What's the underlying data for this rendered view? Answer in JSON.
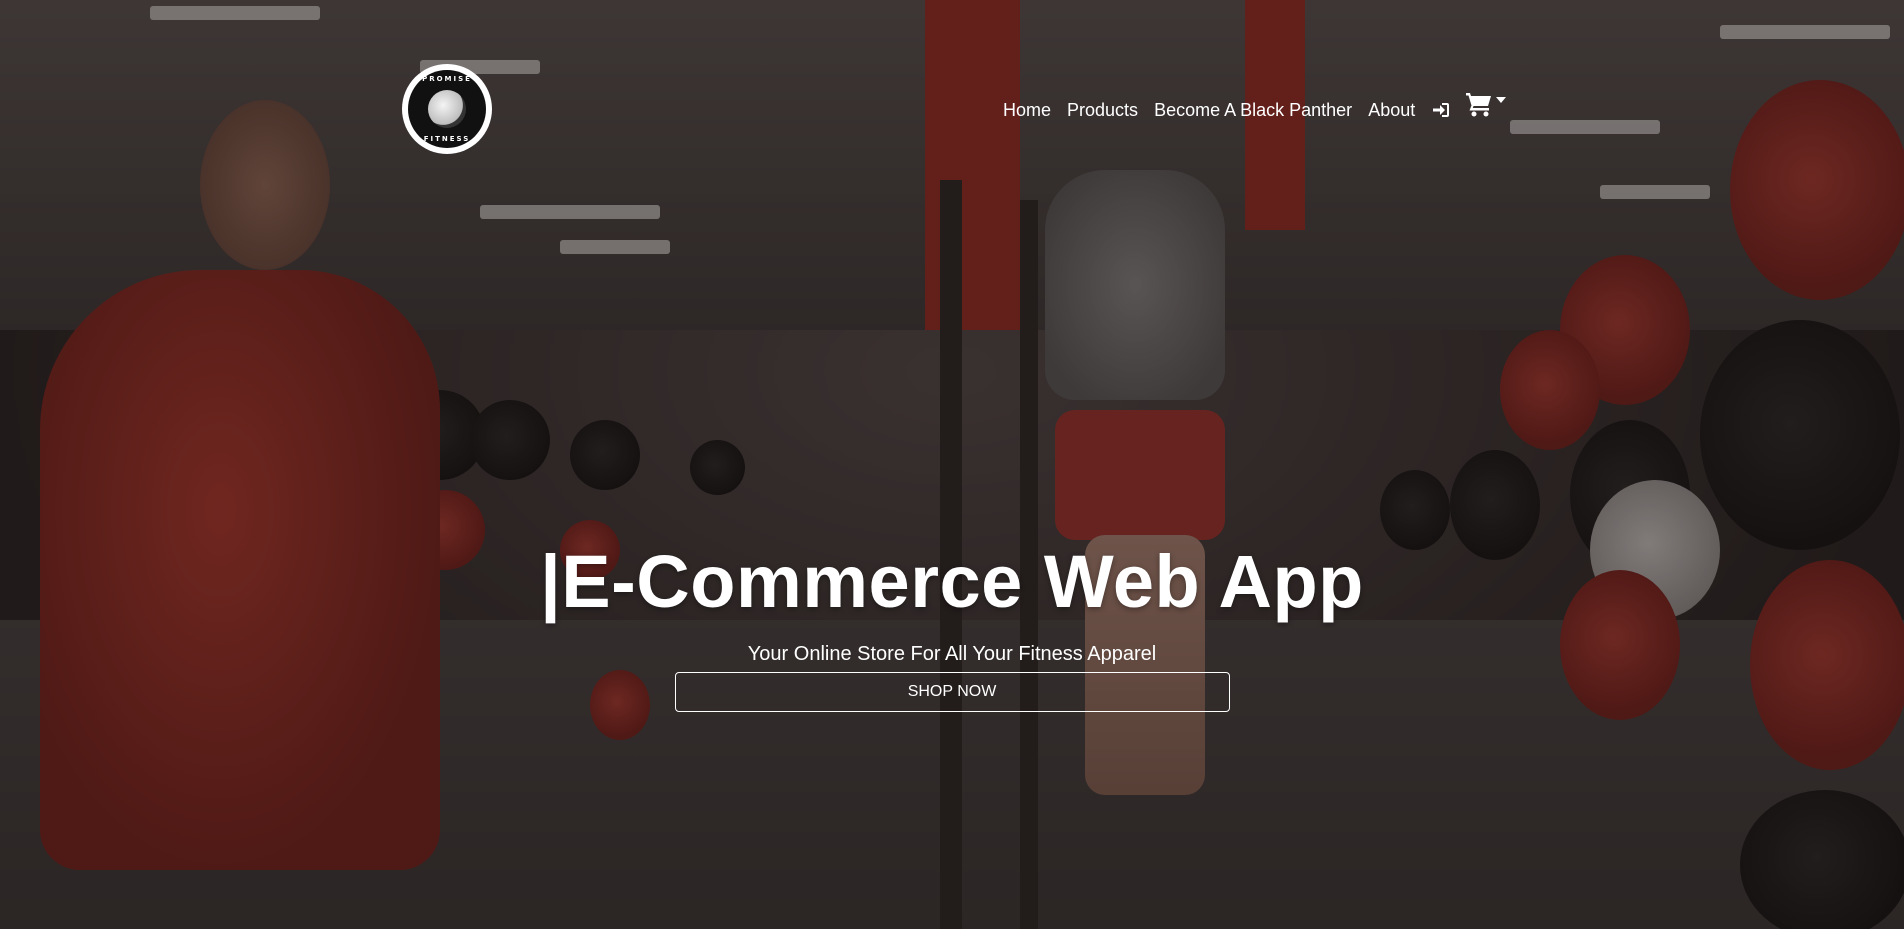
{
  "nav": {
    "logo": {
      "ring_top": "PROMISE",
      "ring_bottom": "FITNESS",
      "icon": "panther-logo-icon"
    },
    "links": [
      "Home",
      "Products",
      "Become A Black Panther",
      "About"
    ],
    "login_icon": "sign-in-icon",
    "cart_icon": "shopping-cart-icon",
    "cart_dropdown_icon": "caret-down-icon"
  },
  "hero": {
    "title": "|E-Commerce Web App",
    "subtitle": "Your Online Store For All Your Fitness Apparel",
    "cta_label": "SHOP NOW"
  },
  "colors": {
    "text": "#ffffff",
    "overlay": "#191212",
    "accent_red": "#a8322a"
  }
}
